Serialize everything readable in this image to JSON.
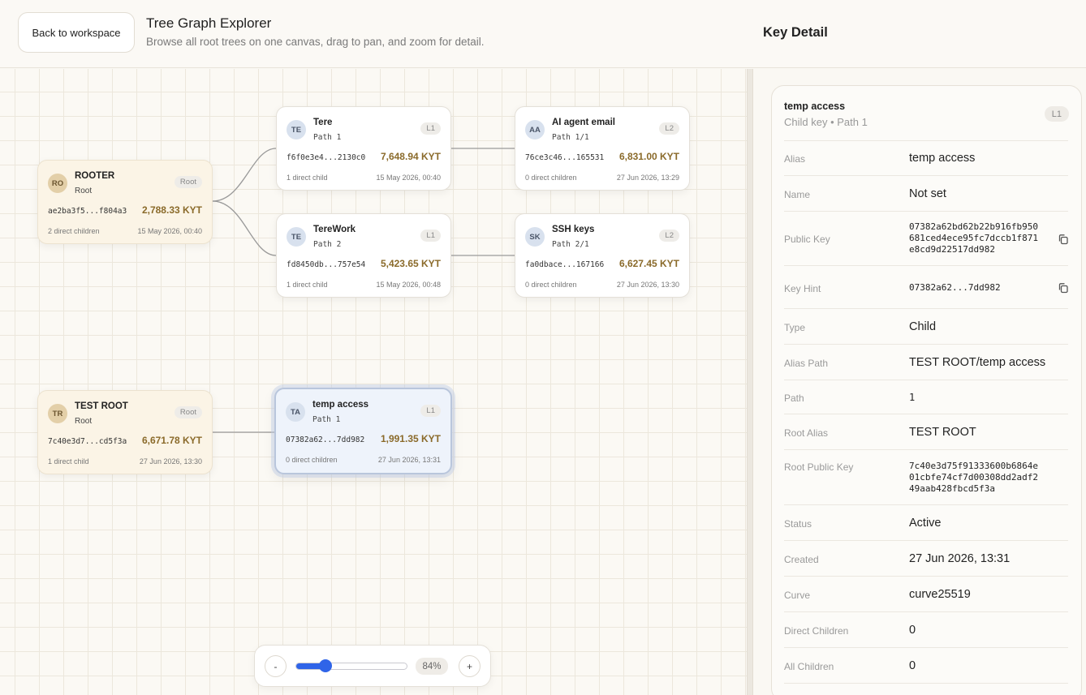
{
  "header": {
    "back_label": "Back to workspace",
    "title": "Tree Graph Explorer",
    "subtitle": "Browse all root trees on one canvas, drag to pan, and zoom for detail.",
    "panel_title": "Key Detail"
  },
  "nodes": {
    "rooter": {
      "initials": "RO",
      "name": "ROOTER",
      "sub": "Root",
      "badge": "Root",
      "key": "ae2ba3f5...f804a3",
      "amount": "2,788.33 KYT",
      "children": "2 direct children",
      "date": "15 May 2026, 00:40"
    },
    "tere": {
      "initials": "TE",
      "name": "Tere",
      "sub": "Path 1",
      "badge": "L1",
      "key": "f6f0e3e4...2130c0",
      "amount": "7,648.94 KYT",
      "children": "1 direct child",
      "date": "15 May 2026, 00:40"
    },
    "terework": {
      "initials": "TE",
      "name": "TereWork",
      "sub": "Path 2",
      "badge": "L1",
      "key": "fd8450db...757e54",
      "amount": "5,423.65 KYT",
      "children": "1 direct child",
      "date": "15 May 2026, 00:48"
    },
    "ai_agent": {
      "initials": "AA",
      "name": "AI agent email",
      "sub": "Path 1/1",
      "badge": "L2",
      "key": "76ce3c46...165531",
      "amount": "6,831.00 KYT",
      "children": "0 direct children",
      "date": "27 Jun 2026, 13:29"
    },
    "ssh": {
      "initials": "SK",
      "name": "SSH keys",
      "sub": "Path 2/1",
      "badge": "L2",
      "key": "fa0dbace...167166",
      "amount": "6,627.45 KYT",
      "children": "0 direct children",
      "date": "27 Jun 2026, 13:30"
    },
    "test_root": {
      "initials": "TR",
      "name": "TEST ROOT",
      "sub": "Root",
      "badge": "Root",
      "key": "7c40e3d7...cd5f3a",
      "amount": "6,671.78 KYT",
      "children": "1 direct child",
      "date": "27 Jun 2026, 13:30"
    },
    "temp_access": {
      "initials": "TA",
      "name": "temp access",
      "sub": "Path 1",
      "badge": "L1",
      "key": "07382a62...7dd982",
      "amount": "1,991.35 KYT",
      "children": "0 direct children",
      "date": "27 Jun 2026, 13:31"
    }
  },
  "zoom": {
    "minus": "-",
    "plus": "+",
    "label": "84%",
    "level": 0.27
  },
  "detail": {
    "title": "temp access",
    "subtitle": "Child key • Path 1",
    "badge": "L1",
    "rows": [
      {
        "label": "Alias",
        "value": "temp access"
      },
      {
        "label": "Name",
        "value": "Not set"
      },
      {
        "label": "Public Key",
        "value": "07382a62bd62b22b916fb950681ced4ece95fc7dccb1f871e8cd9d22517dd982"
      },
      {
        "label": "Key Hint",
        "value": "07382a62...7dd982"
      },
      {
        "label": "Type",
        "value": "Child"
      },
      {
        "label": "Alias Path",
        "value": "TEST ROOT/temp access"
      },
      {
        "label": "Path",
        "value": "1"
      },
      {
        "label": "Root Alias",
        "value": "TEST ROOT"
      },
      {
        "label": "Root Public Key",
        "value": "7c40e3d75f91333600b6864e01cbfe74cf7d00308dd2adf249aab428fbcd5f3a"
      },
      {
        "label": "Status",
        "value": "Active"
      },
      {
        "label": "Created",
        "value": "27 Jun 2026, 13:31"
      },
      {
        "label": "Curve",
        "value": "curve25519"
      },
      {
        "label": "Direct Children",
        "value": "0"
      },
      {
        "label": "All Children",
        "value": "0"
      }
    ]
  },
  "icons": {
    "copy": "copy-icon"
  }
}
